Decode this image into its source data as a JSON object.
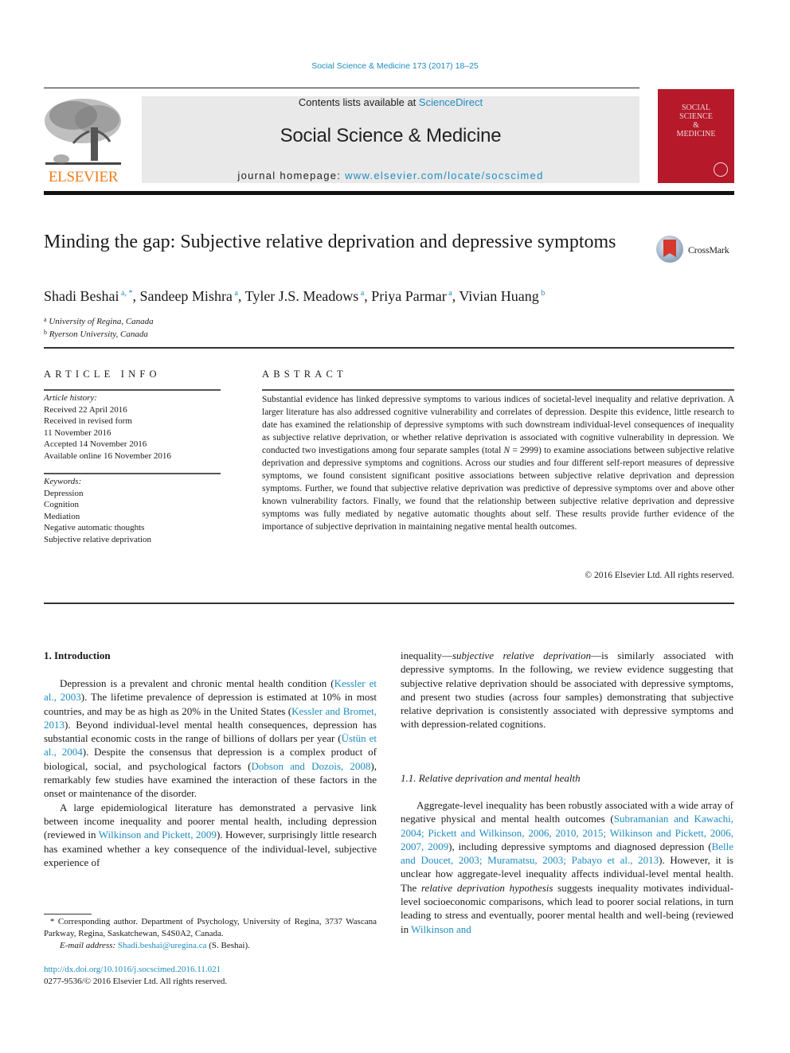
{
  "header": {
    "citation": "Social Science & Medicine 173 (2017) 18–25",
    "contents_prefix": "Contents lists available at ",
    "contents_link": "ScienceDirect",
    "journal_name": "Social Science & Medicine",
    "homepage_prefix": "journal homepage: ",
    "homepage_link": "www.elsevier.com/locate/socscimed",
    "publisher_logo": "ELSEVIER",
    "cover_title": [
      "SOCIAL",
      "SCIENCE",
      "&",
      "MEDICINE"
    ],
    "crossmark_label": "CrossMark"
  },
  "article": {
    "title": "Minding the gap: Subjective relative deprivation and depressive symptoms",
    "authors": [
      {
        "name": "Shadi Beshai",
        "sup": "a, *"
      },
      {
        "name": "Sandeep Mishra",
        "sup": "a"
      },
      {
        "name": "Tyler J.S. Meadows",
        "sup": "a"
      },
      {
        "name": "Priya Parmar",
        "sup": "a"
      },
      {
        "name": "Vivian Huang",
        "sup": "b"
      }
    ],
    "affiliations": [
      {
        "sup": "a",
        "text": "University of Regina, Canada"
      },
      {
        "sup": "b",
        "text": "Ryerson University, Canada"
      }
    ]
  },
  "article_info": {
    "label": "ARTICLE INFO",
    "history_label": "Article history:",
    "history": [
      "Received 22 April 2016",
      "Received in revised form",
      "11 November 2016",
      "Accepted 14 November 2016",
      "Available online 16 November 2016"
    ],
    "keywords_label": "Keywords:",
    "keywords": [
      "Depression",
      "Cognition",
      "Mediation",
      "Negative automatic thoughts",
      "Subjective relative deprivation"
    ]
  },
  "abstract": {
    "label": "ABSTRACT",
    "text_1": "Substantial evidence has linked depressive symptoms to various indices of societal-level inequality and relative deprivation. A larger literature has also addressed cognitive vulnerability and correlates of depression. Despite this evidence, little research to date has examined the relationship of depressive symptoms with such downstream individual-level consequences of inequality as subjective relative deprivation, or whether relative deprivation is associated with cognitive vulnerability in depression. We conducted two investigations among four separate samples (total ",
    "text_n": "N",
    "text_2": " = 2999) to examine associations between subjective relative deprivation and depressive symptoms and cognitions. Across our studies and four different self-report measures of depressive symptoms, we found consistent significant positive associations between subjective relative deprivation and depression symptoms. Further, we found that subjective relative deprivation was predictive of depressive symptoms over and above other known vulnerability factors. Finally, we found that the relationship between subjective relative deprivation and depressive symptoms was fully mediated by negative automatic thoughts about self. These results provide further evidence of the importance of subjective deprivation in maintaining negative mental health outcomes.",
    "copyright": "© 2016 Elsevier Ltd. All rights reserved."
  },
  "body": {
    "section1_heading": "1.  Introduction",
    "left_p1": [
      {
        "t": "Depression is a prevalent and chronic mental health condition ("
      },
      {
        "t": "Kessler et al., 2003",
        "link": true
      },
      {
        "t": "). The lifetime prevalence of depression is estimated at 10% in most countries, and may be as high as 20% in the United States ("
      },
      {
        "t": "Kessler and Bromet, 2013",
        "link": true
      },
      {
        "t": "). Beyond individual-level mental health consequences, depression has substantial economic costs in the range of billions of dollars per year ("
      },
      {
        "t": "Üstün et al., 2004",
        "link": true
      },
      {
        "t": "). Despite the consensus that depression is a complex product of biological, social, and psychological factors ("
      },
      {
        "t": "Dobson and Dozois, 2008",
        "link": true
      },
      {
        "t": "), remarkably few studies have examined the interaction of these factors in the onset or maintenance of the disorder."
      }
    ],
    "left_p2": [
      {
        "t": "A large epidemiological literature has demonstrated a pervasive link between income inequality and poorer mental health, including depression (reviewed in "
      },
      {
        "t": "Wilkinson and Pickett, 2009",
        "link": true
      },
      {
        "t": "). However, surprisingly little research has examined whether a key consequence of the individual-level, subjective experience of"
      }
    ],
    "right_p1": [
      {
        "t": "inequality—"
      },
      {
        "t": "subjective relative deprivation",
        "italic": true
      },
      {
        "t": "—is similarly associated with depressive symptoms. In the following, we review evidence suggesting that subjective relative deprivation should be associated with depressive symptoms, and present two studies (across four samples) demonstrating that subjective relative deprivation is consistently associated with depressive symptoms and with depression-related cognitions."
      }
    ],
    "section1_1_heading": "1.1.  Relative deprivation and mental health",
    "right_p2": [
      {
        "t": "Aggregate-level inequality has been robustly associated with a wide array of negative physical and mental health outcomes ("
      },
      {
        "t": "Subramanian and Kawachi, 2004; Pickett and Wilkinson, 2006, 2010, 2015; Wilkinson and Pickett, 2006, 2007, 2009",
        "link": true
      },
      {
        "t": "), including depressive symptoms and diagnosed depression ("
      },
      {
        "t": "Belle and Doucet, 2003; Muramatsu, 2003; Pabayo et al., 2013",
        "link": true
      },
      {
        "t": "). However, it is unclear how aggregate-level inequality affects individual-level mental health. The "
      },
      {
        "t": "relative deprivation hypothesis",
        "italic": true
      },
      {
        "t": " suggests inequality motivates individual-level socioeconomic comparisons, which lead to poorer social relations, in turn leading to stress and eventually, poorer mental health and well-being (reviewed in "
      },
      {
        "t": "Wilkinson and",
        "link": true
      }
    ]
  },
  "footnote": {
    "corresponding": "* Corresponding author. Department of Psychology, University of Regina, 3737 Wascana Parkway, Regina, Saskatchewan, S4S0A2, Canada.",
    "email_label": "E-mail address: ",
    "email": "Shadi.beshai@uregina.ca",
    "email_suffix": " (S. Beshai).",
    "doi": "http://dx.doi.org/10.1016/j.socscimed.2016.11.021",
    "issn": "0277-9536/© 2016 Elsevier Ltd. All rights reserved."
  },
  "colors": {
    "link": "#1f8cc0",
    "elsevier_orange": "#f07d1d",
    "cover_red": "#b5192a",
    "masthead_gray": "#e9e9e9"
  }
}
